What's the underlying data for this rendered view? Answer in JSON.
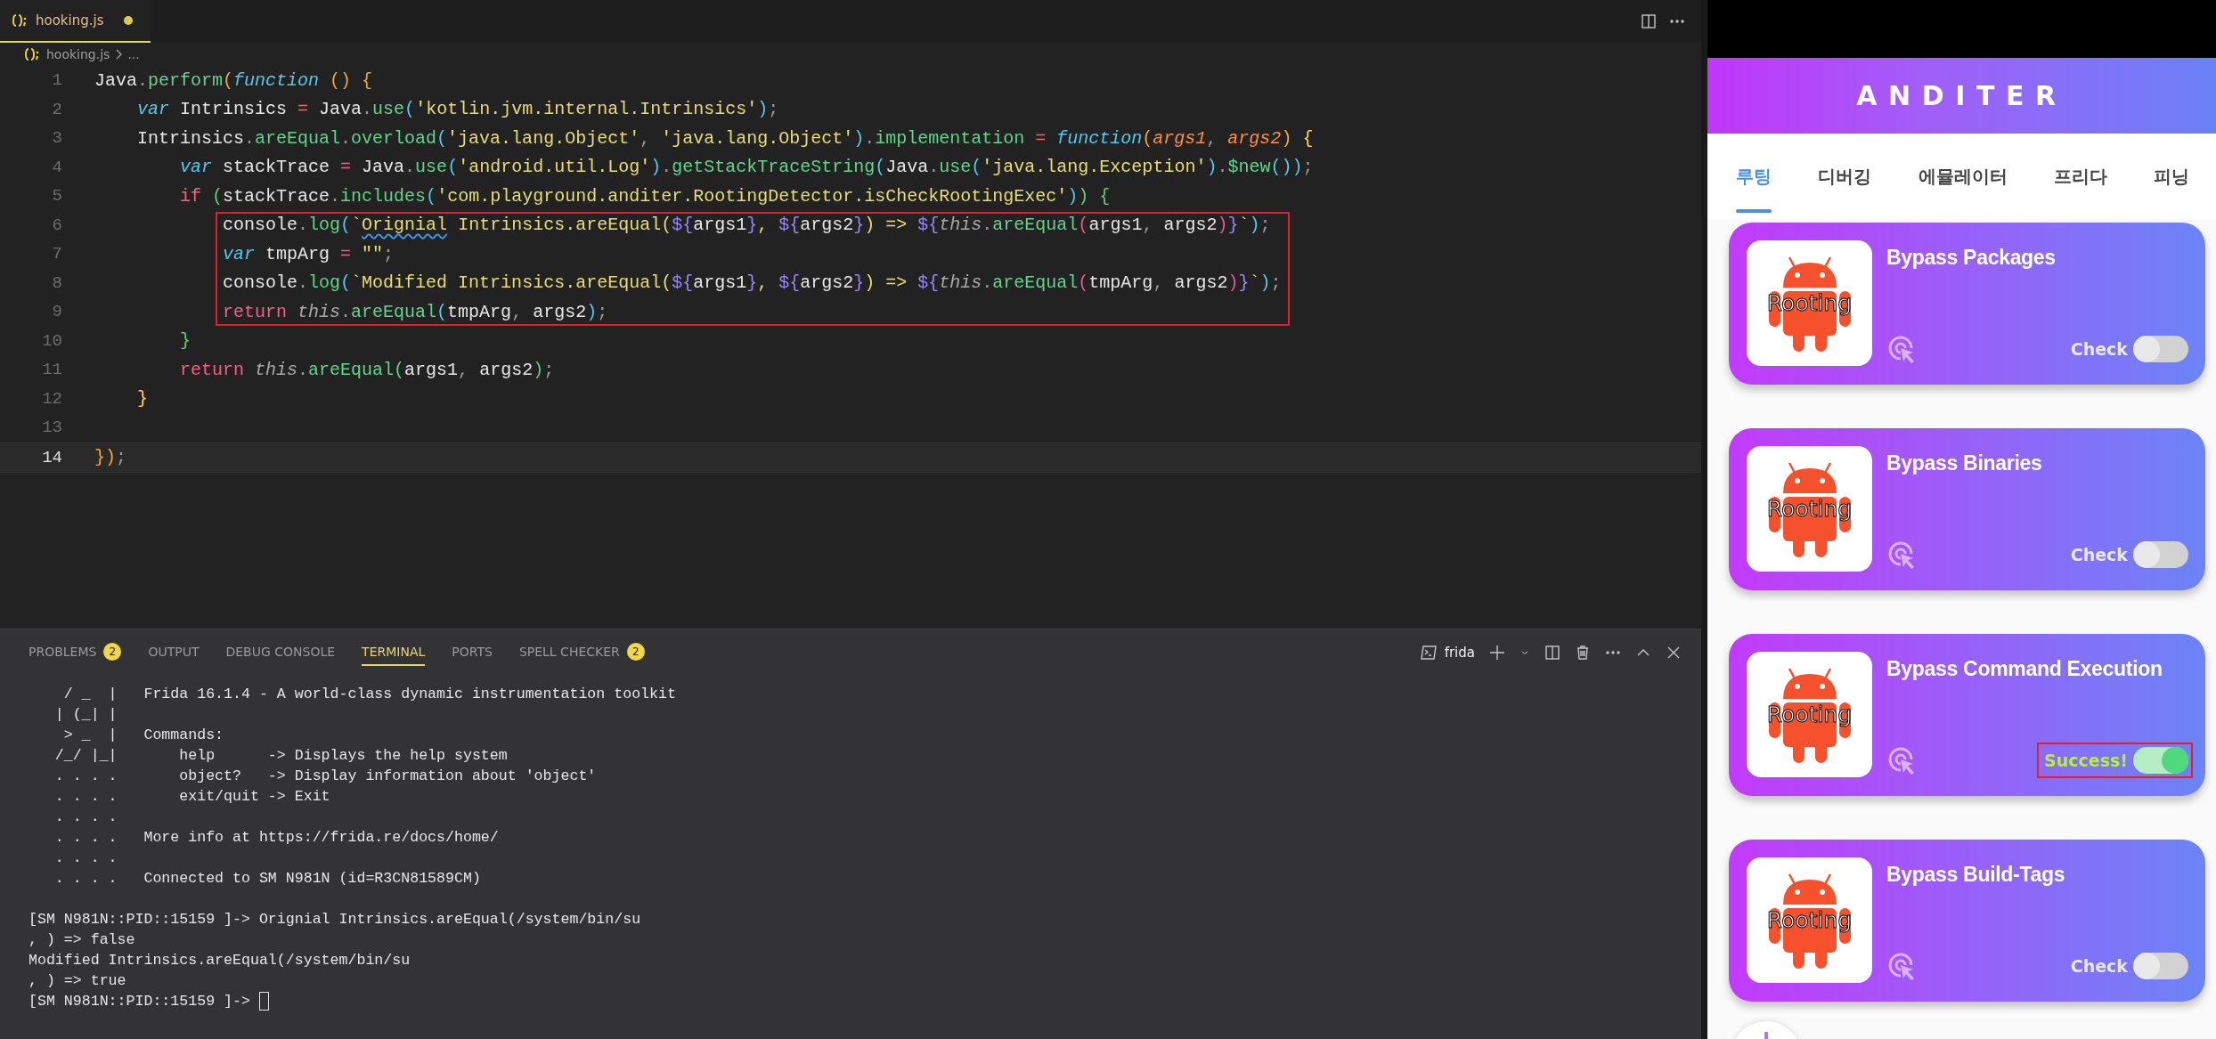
{
  "editor": {
    "tab": {
      "title": "hooking.js",
      "modified": true
    },
    "breadcrumb": [
      "hooking.js",
      "..."
    ],
    "lines": [
      {
        "number": "1",
        "current": false,
        "boxed": false,
        "tokens": [
          {
            "kind": "plain",
            "text": "Java"
          },
          {
            "kind": "punct",
            "text": "."
          },
          {
            "kind": "method",
            "text": "perform"
          },
          {
            "kind": "bracket1",
            "text": "("
          },
          {
            "kind": "keyword",
            "text": "function"
          },
          {
            "kind": "bracket1",
            "text": " ()"
          },
          {
            "kind": "bracket1",
            "text": " {"
          }
        ]
      },
      {
        "number": "2",
        "current": false,
        "boxed": false,
        "tokens": [
          {
            "kind": "keyword",
            "text": "    var"
          },
          {
            "kind": "plain",
            "text": " Intrinsics"
          },
          {
            "kind": "op",
            "text": " = "
          },
          {
            "kind": "plain",
            "text": "Java"
          },
          {
            "kind": "punct",
            "text": "."
          },
          {
            "kind": "method",
            "text": "use"
          },
          {
            "kind": "bracket4",
            "text": "("
          },
          {
            "kind": "string",
            "text": "'kotlin.jvm.internal.Intrinsics'"
          },
          {
            "kind": "bracket4",
            "text": ")"
          },
          {
            "kind": "punct",
            "text": ";"
          }
        ]
      },
      {
        "number": "3",
        "current": false,
        "boxed": false,
        "tokens": [
          {
            "kind": "plain",
            "text": "    Intrinsics"
          },
          {
            "kind": "punct",
            "text": "."
          },
          {
            "kind": "method",
            "text": "areEqual"
          },
          {
            "kind": "punct",
            "text": "."
          },
          {
            "kind": "method",
            "text": "overload"
          },
          {
            "kind": "bracket4",
            "text": "("
          },
          {
            "kind": "string",
            "text": "'java.lang.Object'"
          },
          {
            "kind": "punct",
            "text": ", "
          },
          {
            "kind": "string",
            "text": "'java.lang.Object'"
          },
          {
            "kind": "bracket4",
            "text": ")"
          },
          {
            "kind": "punct",
            "text": "."
          },
          {
            "kind": "method",
            "text": "implementation"
          },
          {
            "kind": "op",
            "text": " = "
          },
          {
            "kind": "keyword",
            "text": "function"
          },
          {
            "kind": "bracket1",
            "text": "("
          },
          {
            "kind": "param",
            "text": "args1"
          },
          {
            "kind": "punct",
            "text": ", "
          },
          {
            "kind": "param",
            "text": "args2"
          },
          {
            "kind": "bracket1",
            "text": ")"
          },
          {
            "kind": "bracket2",
            "text": " {"
          }
        ]
      },
      {
        "number": "4",
        "current": false,
        "boxed": false,
        "tokens": [
          {
            "kind": "keyword",
            "text": "        var"
          },
          {
            "kind": "plain",
            "text": " stackTrace"
          },
          {
            "kind": "op",
            "text": " = "
          },
          {
            "kind": "plain",
            "text": "Java"
          },
          {
            "kind": "punct",
            "text": "."
          },
          {
            "kind": "method",
            "text": "use"
          },
          {
            "kind": "bracket4",
            "text": "("
          },
          {
            "kind": "string",
            "text": "'android.util.Log'"
          },
          {
            "kind": "bracket4",
            "text": ")"
          },
          {
            "kind": "punct",
            "text": "."
          },
          {
            "kind": "method",
            "text": "getStackTraceString"
          },
          {
            "kind": "bracket4",
            "text": "("
          },
          {
            "kind": "plain",
            "text": "Java"
          },
          {
            "kind": "punct",
            "text": "."
          },
          {
            "kind": "method",
            "text": "use"
          },
          {
            "kind": "bracket4",
            "text": "("
          },
          {
            "kind": "string",
            "text": "'java.lang.Exception'"
          },
          {
            "kind": "bracket4",
            "text": ")"
          },
          {
            "kind": "punct",
            "text": "."
          },
          {
            "kind": "method",
            "text": "$new"
          },
          {
            "kind": "bracket4",
            "text": "())"
          },
          {
            "kind": "punct",
            "text": ";"
          }
        ]
      },
      {
        "number": "5",
        "current": false,
        "boxed": false,
        "tokens": [
          {
            "kind": "control",
            "text": "        if"
          },
          {
            "kind": "bracket3",
            "text": " ("
          },
          {
            "kind": "plain",
            "text": "stackTrace"
          },
          {
            "kind": "punct",
            "text": "."
          },
          {
            "kind": "method",
            "text": "includes"
          },
          {
            "kind": "bracket4",
            "text": "("
          },
          {
            "kind": "string",
            "text": "'com.playground.anditer.RootingDetector.isCheckRootingExec'"
          },
          {
            "kind": "bracket4",
            "text": ")"
          },
          {
            "kind": "bracket3",
            "text": ")"
          },
          {
            "kind": "bracket3",
            "text": " {"
          }
        ]
      },
      {
        "number": "6",
        "current": false,
        "boxed": true,
        "tokens": [
          {
            "kind": "plain",
            "text": "            console"
          },
          {
            "kind": "punct",
            "text": "."
          },
          {
            "kind": "method",
            "text": "log"
          },
          {
            "kind": "bracket4",
            "text": "("
          },
          {
            "kind": "string",
            "text": "`"
          },
          {
            "kind": "misspelled",
            "text": "Orignial"
          },
          {
            "kind": "string",
            "text": " Intrinsics.areEqual("
          },
          {
            "kind": "interp",
            "text": "${"
          },
          {
            "kind": "plain",
            "text": "args1"
          },
          {
            "kind": "interp",
            "text": "}"
          },
          {
            "kind": "string",
            "text": ", "
          },
          {
            "kind": "interp",
            "text": "${"
          },
          {
            "kind": "plain",
            "text": "args2"
          },
          {
            "kind": "interp",
            "text": "}"
          },
          {
            "kind": "string",
            "text": ") => "
          },
          {
            "kind": "interp",
            "text": "${"
          },
          {
            "kind": "this",
            "text": "this"
          },
          {
            "kind": "punct",
            "text": "."
          },
          {
            "kind": "method",
            "text": "areEqual"
          },
          {
            "kind": "bracket5",
            "text": "("
          },
          {
            "kind": "plain",
            "text": "args1"
          },
          {
            "kind": "punct",
            "text": ", "
          },
          {
            "kind": "plain",
            "text": "args2"
          },
          {
            "kind": "bracket5",
            "text": ")"
          },
          {
            "kind": "interp",
            "text": "}"
          },
          {
            "kind": "string",
            "text": "`"
          },
          {
            "kind": "bracket4",
            "text": ")"
          },
          {
            "kind": "punct",
            "text": ";"
          }
        ]
      },
      {
        "number": "7",
        "current": false,
        "boxed": true,
        "tokens": [
          {
            "kind": "keyword",
            "text": "            var"
          },
          {
            "kind": "plain",
            "text": " tmpArg"
          },
          {
            "kind": "op",
            "text": " = "
          },
          {
            "kind": "string",
            "text": "\"\""
          },
          {
            "kind": "punct",
            "text": ";"
          }
        ]
      },
      {
        "number": "8",
        "current": false,
        "boxed": true,
        "tokens": [
          {
            "kind": "plain",
            "text": "            console"
          },
          {
            "kind": "punct",
            "text": "."
          },
          {
            "kind": "method",
            "text": "log"
          },
          {
            "kind": "bracket4",
            "text": "("
          },
          {
            "kind": "string",
            "text": "`Modified Intrinsics.areEqual("
          },
          {
            "kind": "interp",
            "text": "${"
          },
          {
            "kind": "plain",
            "text": "args1"
          },
          {
            "kind": "interp",
            "text": "}"
          },
          {
            "kind": "string",
            "text": ", "
          },
          {
            "kind": "interp",
            "text": "${"
          },
          {
            "kind": "plain",
            "text": "args2"
          },
          {
            "kind": "interp",
            "text": "}"
          },
          {
            "kind": "string",
            "text": ") => "
          },
          {
            "kind": "interp",
            "text": "${"
          },
          {
            "kind": "this",
            "text": "this"
          },
          {
            "kind": "punct",
            "text": "."
          },
          {
            "kind": "method",
            "text": "areEqual"
          },
          {
            "kind": "bracket5",
            "text": "("
          },
          {
            "kind": "plain",
            "text": "tmpArg"
          },
          {
            "kind": "punct",
            "text": ", "
          },
          {
            "kind": "plain",
            "text": "args2"
          },
          {
            "kind": "bracket5",
            "text": ")"
          },
          {
            "kind": "interp",
            "text": "}"
          },
          {
            "kind": "string",
            "text": "`"
          },
          {
            "kind": "bracket4",
            "text": ")"
          },
          {
            "kind": "punct",
            "text": ";"
          }
        ]
      },
      {
        "number": "9",
        "current": false,
        "boxed": true,
        "tokens": [
          {
            "kind": "control",
            "text": "            return"
          },
          {
            "kind": "this",
            "text": " this"
          },
          {
            "kind": "punct",
            "text": "."
          },
          {
            "kind": "method",
            "text": "areEqual"
          },
          {
            "kind": "bracket4",
            "text": "("
          },
          {
            "kind": "plain",
            "text": "tmpArg"
          },
          {
            "kind": "punct",
            "text": ", "
          },
          {
            "kind": "plain",
            "text": "args2"
          },
          {
            "kind": "bracket4",
            "text": ")"
          },
          {
            "kind": "punct",
            "text": ";"
          }
        ]
      },
      {
        "number": "10",
        "current": false,
        "boxed": false,
        "tokens": [
          {
            "kind": "bracket3",
            "text": "        }"
          }
        ]
      },
      {
        "number": "11",
        "current": false,
        "boxed": false,
        "tokens": [
          {
            "kind": "control",
            "text": "        return"
          },
          {
            "kind": "this",
            "text": " this"
          },
          {
            "kind": "punct",
            "text": "."
          },
          {
            "kind": "method",
            "text": "areEqual"
          },
          {
            "kind": "bracket3",
            "text": "("
          },
          {
            "kind": "plain",
            "text": "args1"
          },
          {
            "kind": "punct",
            "text": ", "
          },
          {
            "kind": "plain",
            "text": "args2"
          },
          {
            "kind": "bracket3",
            "text": ")"
          },
          {
            "kind": "punct",
            "text": ";"
          }
        ]
      },
      {
        "number": "12",
        "current": false,
        "boxed": false,
        "tokens": [
          {
            "kind": "bracket2",
            "text": "    }"
          }
        ]
      },
      {
        "number": "13",
        "current": false,
        "boxed": false
      },
      {
        "number": "14",
        "current": true,
        "boxed": false,
        "tokens": [
          {
            "kind": "bracket1",
            "text": "})"
          },
          {
            "kind": "punct",
            "text": ";"
          }
        ]
      }
    ]
  },
  "panel": {
    "tabs": [
      {
        "label": "PROBLEMS",
        "badge": "2",
        "selected": false
      },
      {
        "label": "OUTPUT",
        "selected": false
      },
      {
        "label": "DEBUG CONSOLE",
        "selected": false
      },
      {
        "label": "TERMINAL",
        "selected": true
      },
      {
        "label": "PORTS",
        "selected": false
      },
      {
        "label": "SPELL CHECKER",
        "badge": "2",
        "selected": false
      }
    ],
    "terminal_name": "frida",
    "banner": [
      "    / _  |   Frida 16.1.4 - A world-class dynamic instrumentation toolkit",
      "   | (_| |",
      "    > _  |   Commands:",
      "   /_/ |_|       help      -> Displays the help system",
      "   . . . .       object?   -> Display information about 'object'",
      "   . . . .       exit/quit -> Exit",
      "   . . . .",
      "   . . . .   More info at https://frida.re/docs/home/",
      "   . . . .",
      "   . . . .   Connected to SM N981N (id=R3CN81589CM)"
    ],
    "session": [
      "[SM N981N::PID::15159 ]-> Orignial Intrinsics.areEqual(/system/bin/su",
      ", ) => false",
      "Modified Intrinsics.areEqual(/system/bin/su",
      ", ) => true"
    ],
    "prompt": "[SM N981N::PID::15159 ]->"
  },
  "phone": {
    "app_title": "ANDITER",
    "tabs": [
      {
        "label": "루팅",
        "selected": true
      },
      {
        "label": "디버깅",
        "selected": false
      },
      {
        "label": "에뮬레이터",
        "selected": false
      },
      {
        "label": "프리다",
        "selected": false
      },
      {
        "label": "피닝",
        "selected": false
      }
    ],
    "cards": [
      {
        "title": "Bypass Packages",
        "image_label": "Rooting",
        "status": "Check",
        "on": false,
        "boxed": false
      },
      {
        "title": "Bypass Binaries",
        "image_label": "Rooting",
        "status": "Check",
        "on": false,
        "boxed": false
      },
      {
        "title": "Bypass Command Execution",
        "image_label": "Rooting",
        "status": "Success!",
        "on": true,
        "boxed": true
      },
      {
        "title": "Bypass Build-Tags",
        "image_label": "Rooting",
        "status": "Check",
        "on": false,
        "boxed": false
      }
    ]
  }
}
